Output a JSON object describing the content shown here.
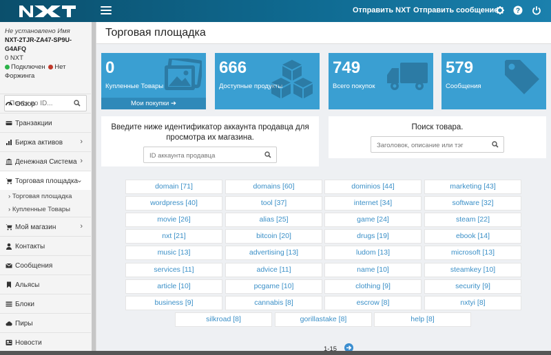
{
  "topbar": {
    "send_nxt": "Отправить NXT",
    "send_message": "Отправить сообщение",
    "icons": [
      "gear-icon",
      "help-icon",
      "power-icon"
    ],
    "color": "#0f6a91"
  },
  "account": {
    "name_status": "Не установлено Имя",
    "id": "NXT-2TJR-ZA47-SP9U-G4AFQ",
    "balance": "0 NXT",
    "connected": "Подключен",
    "not_forging": "Нет Форжинга"
  },
  "sidebar": {
    "search_placeholder": "Поиск по ID...",
    "items": [
      {
        "label": "Обзор",
        "icon": "dashboard-icon"
      },
      {
        "label": "Транзакции",
        "icon": "transactions-icon"
      },
      {
        "label": "Биржа активов",
        "icon": "chart-icon"
      },
      {
        "label": "Денежная Система",
        "icon": "bank-icon"
      },
      {
        "label": "Торговая площадка",
        "icon": "cart-icon"
      },
      {
        "label": "Мой магазин",
        "icon": "shop-cart-icon"
      },
      {
        "label": "Контакты",
        "icon": "user-icon"
      },
      {
        "label": "Сообщения",
        "icon": "envelope-icon"
      },
      {
        "label": "Альясы",
        "icon": "bookmark-icon"
      },
      {
        "label": "Блоки",
        "icon": "list-icon"
      },
      {
        "label": "Пиры",
        "icon": "cloud-icon"
      },
      {
        "label": "Новости",
        "icon": "news-icon"
      }
    ],
    "subitems": [
      "Торговая площадка",
      "Купленные Товары"
    ]
  },
  "page": {
    "title": "Торговая площадка"
  },
  "stats": [
    {
      "value": "0",
      "label": "Купленные Товары",
      "footer": "Мои покупки",
      "icon": "picture-icon"
    },
    {
      "value": "666",
      "label": "Доступные продукты",
      "icon": "cubes-icon"
    },
    {
      "value": "749",
      "label": "Всего покупок",
      "icon": "truck-icon"
    },
    {
      "value": "579",
      "label": "Сообщения",
      "icon": "tag-icon"
    }
  ],
  "seller_search": {
    "text": "Введите ниже идентификатор аккаунта продавца для просмотра их магазина.",
    "placeholder": "ID аккаунта продавца"
  },
  "product_search": {
    "text": "Поиск товара.",
    "placeholder": "Заголовок, описание или тэг"
  },
  "tags": [
    "domain [71]",
    "domains [60]",
    "dominios [44]",
    "marketing [43]",
    "wordpress [40]",
    "tool [37]",
    "internet [34]",
    "software [32]",
    "movie [26]",
    "alias [25]",
    "game [24]",
    "steam [22]",
    "nxt [21]",
    "bitcoin [20]",
    "drugs [19]",
    "ebook [14]",
    "music [13]",
    "advertising [13]",
    "ludom [13]",
    "microsoft [13]",
    "services [11]",
    "advice [11]",
    "name [10]",
    "steamkey [10]",
    "article [10]",
    "pcgame [10]",
    "clothing [9]",
    "security [9]",
    "business [9]",
    "cannabis [8]",
    "escrow [8]",
    "nxtyi [8]",
    "silkroad [8]",
    "gorillastake [8]",
    "help [8]"
  ],
  "pagination": {
    "label": "1-15",
    "icon": "arrow-right-circle-icon"
  },
  "colors": {
    "accent": "#3a9fd2",
    "link": "#3a8fc7",
    "connected": "#2db34a",
    "not_forging": "#c0392b"
  }
}
